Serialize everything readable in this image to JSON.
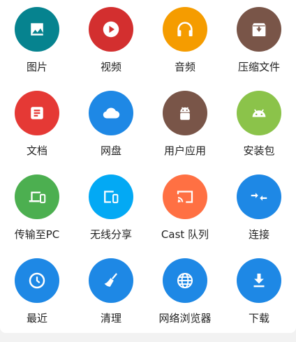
{
  "tiles": [
    {
      "label": "图片",
      "icon": "image-icon",
      "color": "#06838f"
    },
    {
      "label": "视频",
      "icon": "play-icon",
      "color": "#d32f2f"
    },
    {
      "label": "音频",
      "icon": "headphones-icon",
      "color": "#f59c00"
    },
    {
      "label": "压缩文件",
      "icon": "archive-icon",
      "color": "#795548"
    },
    {
      "label": "文档",
      "icon": "document-icon",
      "color": "#e53935"
    },
    {
      "label": "网盘",
      "icon": "cloud-icon",
      "color": "#1e88e5"
    },
    {
      "label": "用户应用",
      "icon": "android-icon",
      "color": "#795548"
    },
    {
      "label": "安装包",
      "icon": "android-icon",
      "color": "#8bc34a"
    },
    {
      "label": "传输至PC",
      "icon": "devices-icon",
      "color": "#4caf50"
    },
    {
      "label": "无线分享",
      "icon": "phonelink-icon",
      "color": "#03a9f4"
    },
    {
      "label": "Cast 队列",
      "icon": "cast-icon",
      "color": "#ff7043"
    },
    {
      "label": "连接",
      "icon": "compress-arrows-icon",
      "color": "#1e88e5"
    },
    {
      "label": "最近",
      "icon": "clock-icon",
      "color": "#1e88e5"
    },
    {
      "label": "清理",
      "icon": "broom-icon",
      "color": "#1e88e5"
    },
    {
      "label": "网络浏览器",
      "icon": "globe-icon",
      "color": "#1e88e5"
    },
    {
      "label": "下载",
      "icon": "download-icon",
      "color": "#1e88e5"
    }
  ]
}
